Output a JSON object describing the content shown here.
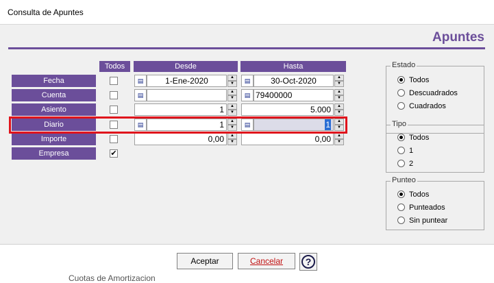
{
  "window": {
    "title": "Consulta de Apuntes"
  },
  "heading": "Apuntes",
  "columns": {
    "todos": "Todos",
    "desde": "Desde",
    "hasta": "Hasta"
  },
  "rows": {
    "fecha": {
      "label": "Fecha",
      "todos": false,
      "desde": "1-Ene-2020",
      "hasta": "30-Oct-2020"
    },
    "cuenta": {
      "label": "Cuenta",
      "todos": false,
      "desde": "",
      "hasta": "79400000"
    },
    "asiento": {
      "label": "Asiento",
      "todos": false,
      "desde": "1",
      "hasta": "5.000"
    },
    "diario": {
      "label": "Diario",
      "todos": false,
      "desde": "1",
      "hasta": "1"
    },
    "importe": {
      "label": "Importe",
      "todos": false,
      "desde": "0,00",
      "hasta": "0,00"
    },
    "empresa": {
      "label": "Empresa",
      "todos": true,
      "check_mark": "✔"
    }
  },
  "estado": {
    "legend": "Estado",
    "options": [
      "Todos",
      "Descuadrados",
      "Cuadrados"
    ],
    "selected": 0
  },
  "tipo": {
    "legend": "Tipo",
    "options": [
      "Todos",
      "1",
      "2"
    ],
    "selected": 0
  },
  "punteo": {
    "legend": "Punteo",
    "options": [
      "Todos",
      "Punteados",
      "Sin puntear"
    ],
    "selected": 0
  },
  "buttons": {
    "accept": "Aceptar",
    "cancel": "Cancelar",
    "help": "?"
  },
  "background_text": "Cuotas de Amortizacion",
  "colors": {
    "accent": "#6b4e9a",
    "highlight": "#e0141c"
  }
}
